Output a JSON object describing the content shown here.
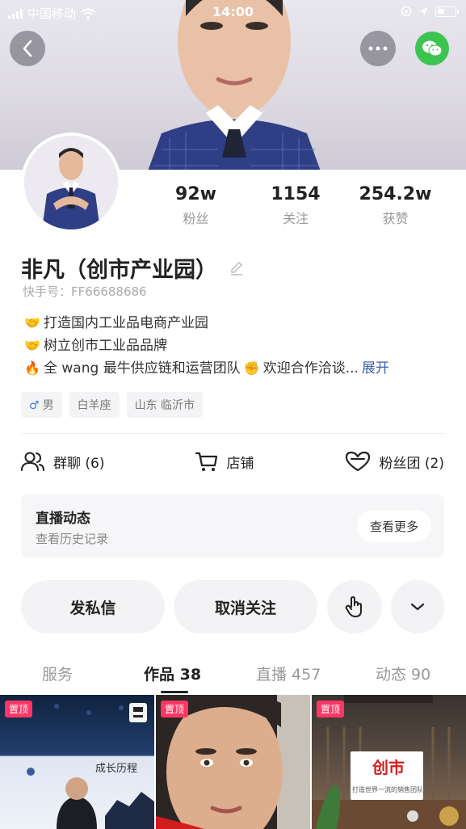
{
  "status_bar": {
    "carrier": "中国移动",
    "time": "14:00"
  },
  "profile": {
    "name": "非凡（创市产业园）",
    "uid": "快手号：FF66688686",
    "stats": [
      {
        "value": "92w",
        "label": "粉丝"
      },
      {
        "value": "1154",
        "label": "关注"
      },
      {
        "value": "254.2w",
        "label": "获赞"
      }
    ],
    "bio": {
      "line1": "打造国内工业品电商产业园",
      "line2": "树立创市工业品品牌",
      "line3a": "全 wang 最牛供应链和运营团队",
      "line3b": "欢迎合作洽谈...",
      "expand": "展开"
    },
    "tags": {
      "gender": "男",
      "zodiac": "白羊座",
      "location": "山东 临沂市"
    }
  },
  "quick_links": {
    "group_chat": "群聊 (6)",
    "store": "店铺",
    "fan_club": "粉丝团 (2)"
  },
  "live_card": {
    "title": "直播动态",
    "subtitle": "查看历史记录",
    "more": "查看更多"
  },
  "actions": {
    "message": "发私信",
    "unfollow": "取消关注"
  },
  "tabs": [
    {
      "label": "服务"
    },
    {
      "label": "作品 38"
    },
    {
      "label": "直播 457"
    },
    {
      "label": "动态 90"
    }
  ],
  "posts": [
    {
      "pin": "置顶",
      "caption": "成长历程"
    },
    {
      "pin": "置顶"
    },
    {
      "pin": "置顶",
      "sign_top": "创市",
      "sign_sub": "打造世界一流的销售团队"
    }
  ],
  "colors": {
    "accent_link": "#385eac",
    "pin_badge": "#fe3666",
    "wechat": "#3cc451"
  }
}
